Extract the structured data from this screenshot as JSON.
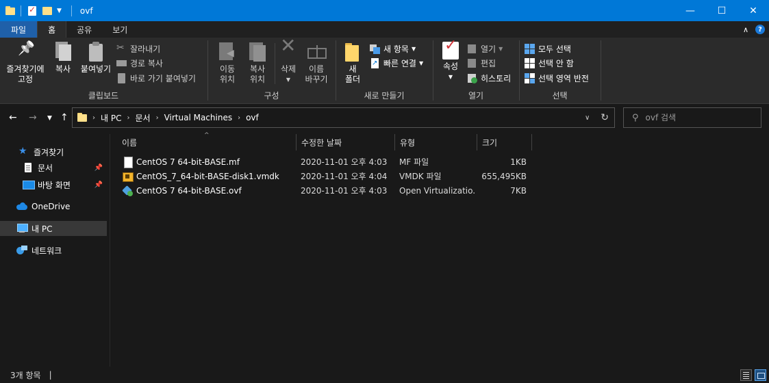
{
  "window": {
    "title": "ovf",
    "controls": {
      "minimize": "—",
      "maximize": "☐",
      "close": "✕"
    }
  },
  "ribbon_tabs": [
    "파일",
    "홈",
    "공유",
    "보기"
  ],
  "ribbon": {
    "clipboard": {
      "label": "클립보드",
      "pin_label_line1": "즐겨찾기에",
      "pin_label_line2": "고정",
      "copy": "복사",
      "paste": "붙여넣기",
      "cut": "잘라내기",
      "copy_path": "경로 복사",
      "paste_shortcut": "바로 가기 붙여넣기"
    },
    "organize": {
      "label": "구성",
      "move_line1": "이동",
      "move_line2": "위치",
      "copy_line1": "복사",
      "copy_line2": "위치",
      "delete": "삭제",
      "rename_line1": "이름",
      "rename_line2": "바꾸기"
    },
    "new": {
      "label": "새로 만들기",
      "new_folder_line1": "새",
      "new_folder_line2": "폴더",
      "new_item": "새 항목",
      "easy_access": "빠른 연결"
    },
    "open": {
      "label": "열기",
      "properties": "속성",
      "open": "열기",
      "edit": "편집",
      "history": "히스토리"
    },
    "select": {
      "label": "선택",
      "select_all": "모두 선택",
      "select_none": "선택 안 함",
      "invert": "선택 영역 반전"
    }
  },
  "nav": {
    "breadcrumb": [
      "내 PC",
      "문서",
      "Virtual Machines",
      "ovf"
    ],
    "search_placeholder": "ovf 검색"
  },
  "sidebar": {
    "items": [
      {
        "label": "즐겨찾기",
        "icon": "star-icon"
      },
      {
        "label": "문서",
        "icon": "document-icon",
        "pinned": true
      },
      {
        "label": "바탕 화면",
        "icon": "desktop-icon",
        "pinned": true
      },
      {
        "label": "OneDrive",
        "icon": "cloud-icon"
      },
      {
        "label": "내 PC",
        "icon": "pc-icon",
        "selected": true
      },
      {
        "label": "네트워크",
        "icon": "network-icon"
      }
    ]
  },
  "filelist": {
    "columns": [
      "이름",
      "수정한 날짜",
      "유형",
      "크기"
    ],
    "rows": [
      {
        "name": "CentOS 7 64-bit-BASE.mf",
        "date": "2020-11-01 오후 4:03",
        "type": "MF 파일",
        "size": "1KB",
        "icon": "mf-file-icon"
      },
      {
        "name": "CentOS_7_64-bit-BASE-disk1.vmdk",
        "date": "2020-11-01 오후 4:04",
        "type": "VMDK 파일",
        "size": "655,495KB",
        "icon": "vmdk-file-icon"
      },
      {
        "name": "CentOS 7 64-bit-BASE.ovf",
        "date": "2020-11-01 오후 4:03",
        "type": "Open Virtualizatio...",
        "size": "7KB",
        "icon": "ovf-file-icon"
      }
    ]
  },
  "status": {
    "item_count": "3개 항목"
  },
  "colors": {
    "titlebar": "#0078d7",
    "file_tab": "#1f60a9",
    "background": "#191919",
    "ribbon": "#2b2b2b"
  }
}
